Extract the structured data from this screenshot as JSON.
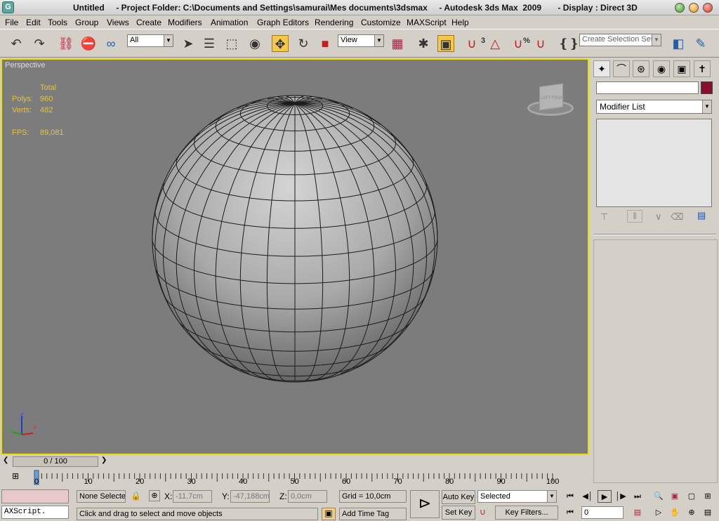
{
  "titlebar": {
    "text": "Untitled     - Project Folder: C:\\Documents and Settings\\samurai\\Mes documents\\3dsmax     - Autodesk 3ds Max  2009       - Display : Direct 3D"
  },
  "menu": [
    "File",
    "Edit",
    "Tools",
    "Group",
    "Views",
    "Create",
    "Modifiers",
    "Animation",
    "Graph Editors",
    "Rendering",
    "Customize",
    "MAXScript",
    "Help"
  ],
  "toolbar": {
    "selection_filter": "All",
    "ref_coord": "View",
    "selection_set_placeholder": "Create Selection Set",
    "snap_angle": "3",
    "percent_snap": "%"
  },
  "viewport": {
    "label": "Perspective",
    "stats_header": "Total",
    "polys_label": "Polys:",
    "polys_value": "960",
    "verts_label": "Verts:",
    "verts_value": "482",
    "fps_label": "FPS:",
    "fps_value": "89,081",
    "axis_x": "x",
    "axis_y": "y",
    "axis_z": "z",
    "viewcube_front": "FRONT",
    "viewcube_left": "LEFT"
  },
  "command_panel": {
    "modifier_list": "Modifier List"
  },
  "timeline": {
    "slider_label": "0 / 100",
    "ticks": [
      "0",
      "10",
      "20",
      "30",
      "40",
      "50",
      "60",
      "70",
      "80",
      "90",
      "100"
    ]
  },
  "status": {
    "maxscript_listener": "AXScript.",
    "selection_info": "None Selecte",
    "prompt": "Click and drag to select and move objects",
    "x_label": "X:",
    "x_value": "-11,7cm",
    "y_label": "Y:",
    "y_value": "-47,188cm",
    "z_label": "Z:",
    "z_value": "0,0cm",
    "grid": "Grid = 10,0cm",
    "add_time_tag": "Add Time Tag",
    "auto_key": "Auto Key",
    "set_key": "Set Key",
    "key_mode": "Selected",
    "key_filters": "Key Filters...",
    "frame": "0"
  },
  "colors": {
    "viewport_bg": "#7c7c7c",
    "active_border": "#ece000",
    "stats_text": "#e8c23a",
    "object_color": "#8a0e2e"
  }
}
